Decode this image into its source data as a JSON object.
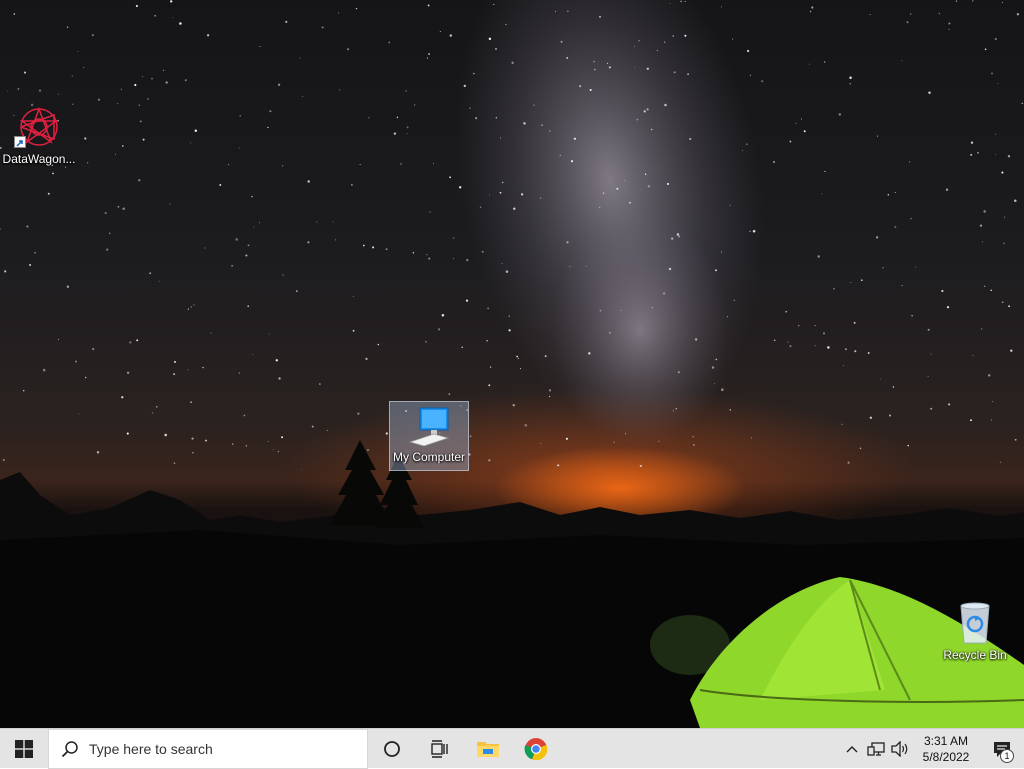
{
  "desktop": {
    "icons": [
      {
        "label": "DataWagon...",
        "icon": "datawagon-icon"
      },
      {
        "label": "My Computer",
        "icon": "computer-icon",
        "selected": true
      },
      {
        "label": "Recycle Bin",
        "icon": "recycle-bin-icon"
      }
    ]
  },
  "taskbar": {
    "search_placeholder": "Type here to search",
    "apps": [
      "cortana-icon",
      "task-view-icon",
      "file-explorer-icon",
      "chrome-icon"
    ],
    "tray": {
      "time": "3:31 AM",
      "date": "5/8/2022",
      "notification_count": "1"
    }
  },
  "colors": {
    "taskbar_bg": "#e4e4e4",
    "tent_green": "#9be82a",
    "horizon_glow": "#ff6e14"
  }
}
